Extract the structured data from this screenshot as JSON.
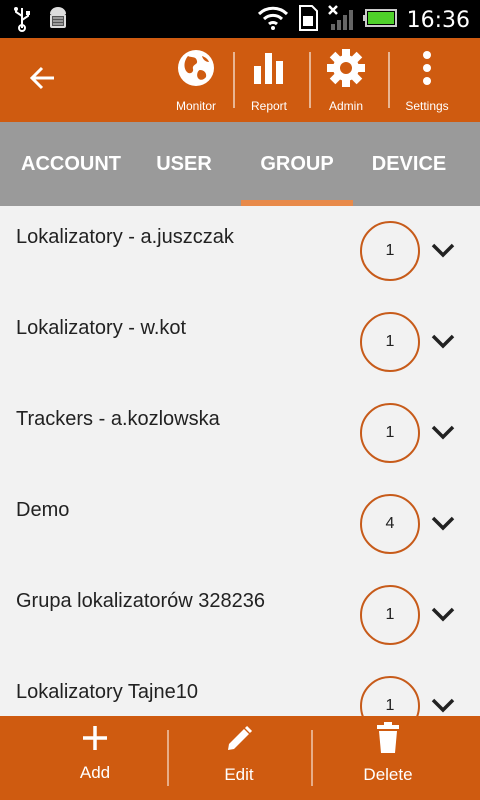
{
  "status_bar": {
    "time": "16:36",
    "icons": [
      "usb-icon",
      "android-debug-icon",
      "wifi-icon",
      "sim-icon",
      "signal-icon",
      "battery-icon"
    ]
  },
  "toolbar": {
    "back_icon": "arrow-left-icon",
    "items": [
      {
        "label": "Monitor",
        "icon": "globe-icon"
      },
      {
        "label": "Report",
        "icon": "bar-chart-icon"
      },
      {
        "label": "Admin",
        "icon": "gear-icon"
      },
      {
        "label": "Settings",
        "icon": "more-vertical-icon"
      }
    ]
  },
  "tabs": {
    "items": [
      {
        "label": "ACCOUNT"
      },
      {
        "label": "USER"
      },
      {
        "label": "GROUP"
      },
      {
        "label": "DEVICE"
      }
    ],
    "active": "GROUP"
  },
  "groups": [
    {
      "name": "Lokalizatory - a.juszczak",
      "count": "1"
    },
    {
      "name": "Lokalizatory - w.kot",
      "count": "1"
    },
    {
      "name": "Trackers - a.kozlowska",
      "count": "1"
    },
    {
      "name": "Demo",
      "count": "4"
    },
    {
      "name": "Grupa lokalizatorów 328236",
      "count": "1"
    },
    {
      "name": "Lokalizatory Tajne10",
      "count": "1"
    }
  ],
  "bottom_bar": {
    "items": [
      {
        "label": "Add",
        "icon": "plus-icon"
      },
      {
        "label": "Edit",
        "icon": "pencil-icon"
      },
      {
        "label": "Delete",
        "icon": "trash-icon"
      }
    ]
  },
  "colors": {
    "accent": "#cf5b10",
    "tab_bg": "#9a9a9a",
    "tab_indicator": "#e88a4a",
    "badge_border": "#c75b1a",
    "list_bg": "#f2f2f2"
  }
}
